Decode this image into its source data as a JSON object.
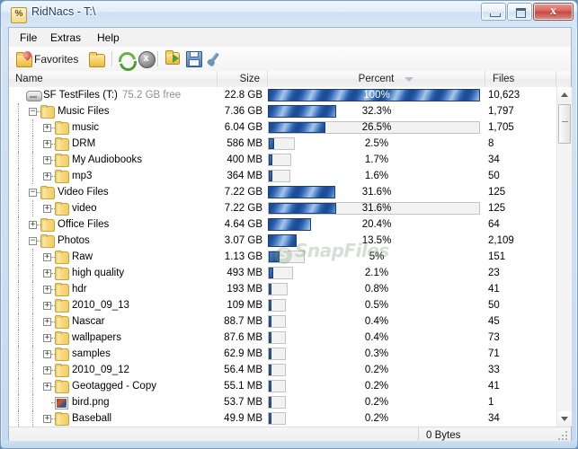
{
  "window": {
    "title": "RidNacs - T:\\",
    "icon": "app-icon",
    "controls": {
      "minimize": "–",
      "maximize": "□",
      "close": "x"
    }
  },
  "menu": {
    "items": [
      {
        "label": "File"
      },
      {
        "label": "Extras"
      },
      {
        "label": "Help"
      }
    ]
  },
  "toolbar": {
    "favorites_label": "Favorites",
    "buttons": [
      {
        "name": "favorites",
        "label": "Favorites"
      },
      {
        "name": "open-folder",
        "label": ""
      },
      {
        "name": "refresh",
        "label": ""
      },
      {
        "name": "stop",
        "label": "x"
      },
      {
        "name": "export",
        "label": ""
      },
      {
        "name": "save",
        "label": ""
      },
      {
        "name": "settings",
        "label": ""
      }
    ]
  },
  "columns": {
    "name": "Name",
    "size": "Size",
    "percent": "Percent",
    "files": "Files",
    "sort": "descending"
  },
  "watermark": {
    "badge": "S",
    "text": "SnapFiles"
  },
  "statusbar": {
    "value": "0 Bytes"
  },
  "rows": [
    {
      "name": "SF TestFiles (T:)",
      "extra": "75.2 GB free",
      "size": "22.8 GB",
      "percent": "100%",
      "pct_value": 100,
      "files": "10,623",
      "depth": 0,
      "icon": "drive",
      "twisty": "none",
      "track": false,
      "label_on_bar": true
    },
    {
      "name": "Music Files",
      "extra": "",
      "size": "7.36 GB",
      "percent": "32.3%",
      "pct_value": 32.3,
      "files": "1,797",
      "depth": 1,
      "icon": "folder",
      "twisty": "minus",
      "track": false,
      "label_on_bar": false
    },
    {
      "name": "music",
      "extra": "",
      "size": "6.04 GB",
      "percent": "26.5%",
      "pct_value": 26.5,
      "files": "1,705",
      "depth": 2,
      "icon": "folder",
      "twisty": "plus",
      "track": true,
      "label_on_bar": false
    },
    {
      "name": "DRM",
      "extra": "",
      "size": "586 MB",
      "percent": "2.5%",
      "pct_value": 2.5,
      "files": "8",
      "depth": 2,
      "icon": "folder",
      "twisty": "plus",
      "track": true,
      "label_on_bar": false
    },
    {
      "name": "My Audiobooks",
      "extra": "",
      "size": "400 MB",
      "percent": "1.7%",
      "pct_value": 1.7,
      "files": "34",
      "depth": 2,
      "icon": "folder",
      "twisty": "plus",
      "track": true,
      "label_on_bar": false
    },
    {
      "name": "mp3",
      "extra": "",
      "size": "364 MB",
      "percent": "1.6%",
      "pct_value": 1.6,
      "files": "50",
      "depth": 2,
      "icon": "folder",
      "twisty": "plus",
      "track": true,
      "label_on_bar": false
    },
    {
      "name": "Video Files",
      "extra": "",
      "size": "7.22 GB",
      "percent": "31.6%",
      "pct_value": 31.6,
      "files": "125",
      "depth": 1,
      "icon": "folder",
      "twisty": "minus",
      "track": false,
      "label_on_bar": false
    },
    {
      "name": "video",
      "extra": "",
      "size": "7.22 GB",
      "percent": "31.6%",
      "pct_value": 31.6,
      "files": "125",
      "depth": 2,
      "icon": "folder",
      "twisty": "plus",
      "track": true,
      "label_on_bar": false
    },
    {
      "name": "Office Files",
      "extra": "",
      "size": "4.64 GB",
      "percent": "20.4%",
      "pct_value": 20.4,
      "files": "64",
      "depth": 1,
      "icon": "folder",
      "twisty": "plus",
      "track": false,
      "label_on_bar": false
    },
    {
      "name": "Photos",
      "extra": "",
      "size": "3.07 GB",
      "percent": "13.5%",
      "pct_value": 13.5,
      "files": "2,109",
      "depth": 1,
      "icon": "folder",
      "twisty": "minus",
      "track": false,
      "label_on_bar": false
    },
    {
      "name": "Raw",
      "extra": "",
      "size": "1.13 GB",
      "percent": "5%",
      "pct_value": 5,
      "files": "151",
      "depth": 2,
      "icon": "folder",
      "twisty": "plus",
      "track": true,
      "label_on_bar": false
    },
    {
      "name": "high quality",
      "extra": "",
      "size": "493 MB",
      "percent": "2.1%",
      "pct_value": 2.1,
      "files": "23",
      "depth": 2,
      "icon": "folder",
      "twisty": "plus",
      "track": true,
      "label_on_bar": false
    },
    {
      "name": "hdr",
      "extra": "",
      "size": "193 MB",
      "percent": "0.8%",
      "pct_value": 0.8,
      "files": "41",
      "depth": 2,
      "icon": "folder",
      "twisty": "plus",
      "track": true,
      "label_on_bar": false
    },
    {
      "name": "2010_09_13",
      "extra": "",
      "size": "109 MB",
      "percent": "0.5%",
      "pct_value": 0.5,
      "files": "50",
      "depth": 2,
      "icon": "folder",
      "twisty": "plus",
      "track": true,
      "label_on_bar": false
    },
    {
      "name": "Nascar",
      "extra": "",
      "size": "88.7 MB",
      "percent": "0.4%",
      "pct_value": 0.4,
      "files": "45",
      "depth": 2,
      "icon": "folder",
      "twisty": "plus",
      "track": true,
      "label_on_bar": false
    },
    {
      "name": "wallpapers",
      "extra": "",
      "size": "87.6 MB",
      "percent": "0.4%",
      "pct_value": 0.4,
      "files": "73",
      "depth": 2,
      "icon": "folder",
      "twisty": "plus",
      "track": true,
      "label_on_bar": false
    },
    {
      "name": "samples",
      "extra": "",
      "size": "62.9 MB",
      "percent": "0.3%",
      "pct_value": 0.3,
      "files": "71",
      "depth": 2,
      "icon": "folder",
      "twisty": "plus",
      "track": true,
      "label_on_bar": false
    },
    {
      "name": "2010_09_12",
      "extra": "",
      "size": "56.4 MB",
      "percent": "0.2%",
      "pct_value": 0.2,
      "files": "33",
      "depth": 2,
      "icon": "folder",
      "twisty": "plus",
      "track": true,
      "label_on_bar": false
    },
    {
      "name": "Geotagged - Copy",
      "extra": "",
      "size": "55.1 MB",
      "percent": "0.2%",
      "pct_value": 0.2,
      "files": "41",
      "depth": 2,
      "icon": "folder",
      "twisty": "plus",
      "track": true,
      "label_on_bar": false
    },
    {
      "name": "bird.png",
      "extra": "",
      "size": "53.7 MB",
      "percent": "0.2%",
      "pct_value": 0.2,
      "files": "1",
      "depth": 2,
      "icon": "image",
      "twisty": "none",
      "track": true,
      "label_on_bar": false
    },
    {
      "name": "Baseball",
      "extra": "",
      "size": "49.9 MB",
      "percent": "0.2%",
      "pct_value": 0.2,
      "files": "34",
      "depth": 2,
      "icon": "folder",
      "twisty": "plus",
      "track": true,
      "label_on_bar": false
    }
  ]
}
